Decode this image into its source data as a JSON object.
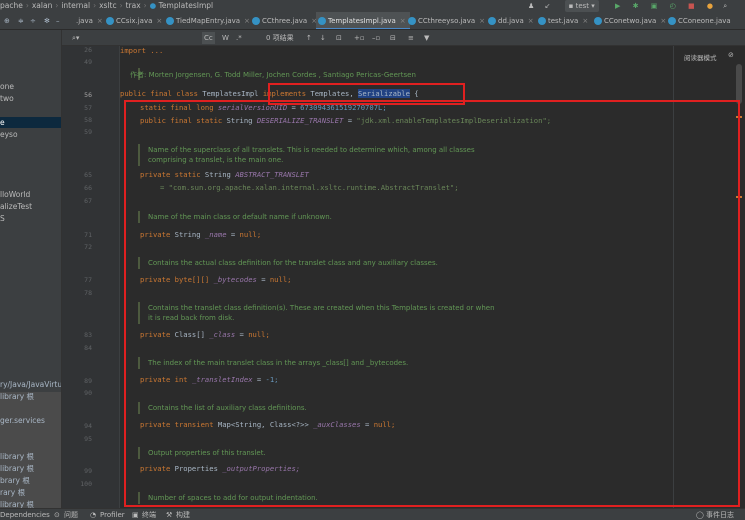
{
  "breadcrumb": [
    "pache",
    "xalan",
    "internal",
    "xsltc",
    "trax",
    "TemplatesImpl"
  ],
  "toolbar": {
    "run_config": "test",
    "run_icon": "play-icon",
    "debug_icon": "bug-icon"
  },
  "tabs": [
    {
      "label": ".java",
      "active": false
    },
    {
      "label": "CCsix.java",
      "active": false
    },
    {
      "label": "TiedMapEntry.java",
      "active": false
    },
    {
      "label": "CCthree.java",
      "active": false
    },
    {
      "label": "TemplatesImpl.java",
      "active": true
    },
    {
      "label": "CCthreeyso.java",
      "active": false
    },
    {
      "label": "dd.java",
      "active": false
    },
    {
      "label": "test.java",
      "active": false
    },
    {
      "label": "CConetwo.java",
      "active": false
    },
    {
      "label": "CConeone.java",
      "active": false
    }
  ],
  "find": {
    "results": "0 项结果"
  },
  "project_items": [
    {
      "label": "one",
      "selected": false
    },
    {
      "label": "two",
      "selected": false
    },
    {
      "label": "e",
      "selected": true
    },
    {
      "label": "eyso",
      "selected": false
    },
    {
      "label": "lloWorld",
      "selected": false
    },
    {
      "label": "alizeTest",
      "selected": false
    },
    {
      "label": "S",
      "selected": false
    },
    {
      "label": "ry/Java/JavaVirtual",
      "selected": false
    },
    {
      "label": "library 根",
      "selected": false
    },
    {
      "label": "ger.services",
      "selected": false
    },
    {
      "label": "library 根",
      "selected": false
    },
    {
      "label": "library 根",
      "selected": false
    },
    {
      "label": "brary 根",
      "selected": false
    },
    {
      "label": "rary 根",
      "selected": false
    },
    {
      "label": "library 根",
      "selected": false
    }
  ],
  "reader_mode": "阅读器模式",
  "editor": {
    "import_line": "import ...",
    "author_line": "作者: Morten Jorgensen, G. Todd Miller, Jochen Cordes , Santiago Pericas-Geertsen",
    "class_decl": {
      "mods": "public final class",
      "name": "TemplatesImpl",
      "implements": "implements",
      "templates": "Templates,",
      "serializable": "Serializable",
      "brace": "{"
    },
    "field_svuid": {
      "kw": "static final long",
      "name": "serialVersionUID",
      "eq": "=",
      "value": "673094361519270707L;"
    },
    "field_deser": {
      "kw": "public final static",
      "type": "String",
      "name": "DESERIALIZE_TRANSLET",
      "eq": "=",
      "value": "\"jdk.xml.enableTemplatesImplDeserialization\";"
    },
    "doc_superclass_1": "Name of the superclass of all translets. This is needed to determine which, among all classes",
    "doc_superclass_2": "comprising a translet, is the main one.",
    "field_abstract": {
      "kw": "private static",
      "type": "String",
      "name": "ABSTRACT_TRANSLET"
    },
    "field_abstract_value": "= \"com.sun.org.apache.xalan.internal.xsltc.runtime.AbstractTranslet\";",
    "doc_name": "Name of the main class or default name if unknown.",
    "field_name": {
      "kw": "private",
      "type": "String",
      "name": "_name",
      "eq": "=",
      "value": "null;"
    },
    "doc_bytecodes": "Contains the actual class definition for the translet class and any auxiliary classes.",
    "field_bytecodes": {
      "kw": "private",
      "type": "byte[][]",
      "name": "_bytecodes",
      "eq": "=",
      "value": "null;"
    },
    "doc_class_1": "Contains the translet class definition(s). These are created when this Templates is created or when",
    "doc_class_2": "it is read back from disk.",
    "field_class": {
      "kw": "private",
      "type": "Class[]",
      "name": "_class",
      "eq": "=",
      "value": "null;"
    },
    "doc_index": "The index of the main translet class in the arrays _class[] and _bytecodes.",
    "field_index": {
      "kw": "private int",
      "name": "_transletIndex",
      "eq": "=",
      "value": "-1;"
    },
    "doc_aux": "Contains the list of auxiliary class definitions.",
    "field_aux": {
      "kw": "private transient",
      "type": "Map<String, Class<?>>",
      "name": "_auxClasses",
      "eq": "=",
      "value": "null;"
    },
    "doc_output": "Output properties of this translet.",
    "field_output": {
      "kw": "private",
      "type": "Properties",
      "name": "_outputProperties;"
    },
    "doc_indent": "Number of spaces to add for output indentation."
  },
  "line_numbers": [
    {
      "n": "26"
    },
    {
      "n": "49"
    },
    {
      "n": "56"
    },
    {
      "n": "57"
    },
    {
      "n": "58"
    },
    {
      "n": "59"
    },
    {
      "n": "65"
    },
    {
      "n": "66"
    },
    {
      "n": "67"
    },
    {
      "n": "71"
    },
    {
      "n": "72"
    },
    {
      "n": "77"
    },
    {
      "n": "78"
    },
    {
      "n": "83"
    },
    {
      "n": "84"
    },
    {
      "n": "89"
    },
    {
      "n": "90"
    },
    {
      "n": "94"
    },
    {
      "n": "95"
    },
    {
      "n": "99"
    },
    {
      "n": "100"
    }
  ],
  "status": {
    "dependencies": "Dependencies",
    "problems": "问题",
    "profiler": "Profiler",
    "terminal": "终端",
    "build": "构建",
    "event_log": "事件日志"
  }
}
